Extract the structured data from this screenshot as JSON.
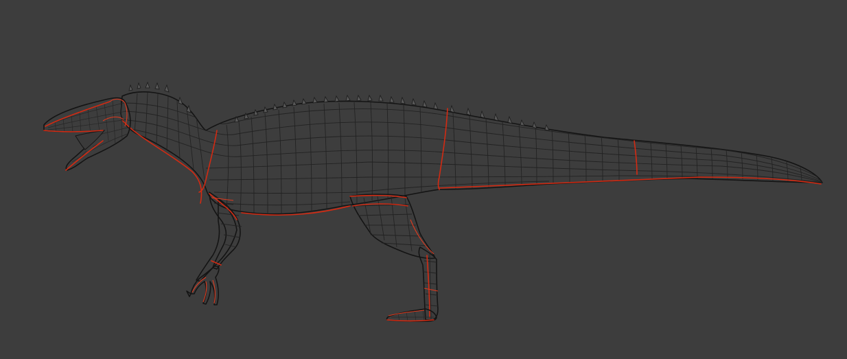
{
  "viewport": {
    "background": "#3d3d3d",
    "mode": "wireframe-over-solid"
  },
  "model": {
    "mesh_color": "#5c5c5c",
    "wire_color": "#222222",
    "seam_color": "#d42a12"
  }
}
